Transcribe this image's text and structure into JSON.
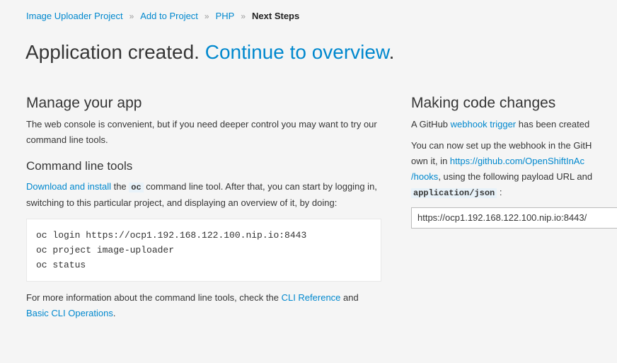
{
  "breadcrumb": {
    "items": [
      "Image Uploader Project",
      "Add to Project",
      "PHP"
    ],
    "separator": "»",
    "current": "Next Steps"
  },
  "title": {
    "text": "Application created. ",
    "link": "Continue to overview",
    "suffix": "."
  },
  "manage": {
    "heading": "Manage your app",
    "intro": "The web console is convenient, but if you need deeper control you may want to try our command line tools.",
    "cli_heading": "Command line tools",
    "download_link": "Download and install",
    "the": " the ",
    "oc": "oc",
    "after": " command line tool. After that, you can start by logging in, switching to this particular project, and displaying an overview of it, by doing:",
    "code_lines": [
      "oc login https://ocp1.192.168.122.100.nip.io:8443",
      "oc project image-uploader",
      "oc status"
    ],
    "more_prefix": "For more information about the command line tools, check the ",
    "cli_reference_link": "CLI Reference",
    "and": " and ",
    "basic_ops_link": "Basic CLI Operations",
    "more_suffix": "."
  },
  "code_changes": {
    "heading": "Making code changes",
    "p1_prefix": "A GitHub ",
    "webhook_link": "webhook trigger",
    "p1_suffix": " has been created",
    "p2_line1": "You can now set up the webhook in the GitH",
    "p2_line2_prefix": "own it, in ",
    "repo_link": "https://github.com/OpenShiftInAc",
    "hooks_link": "/hooks",
    "p2_line3_suffix": ", using the following payload URL and",
    "content_type": "application/json",
    "colon": " :",
    "payload_url": "https://ocp1.192.168.122.100.nip.io:8443/"
  },
  "colors": {
    "link": "#0088ce",
    "background": "#f5f5f5",
    "code_bg": "#ffffff"
  }
}
